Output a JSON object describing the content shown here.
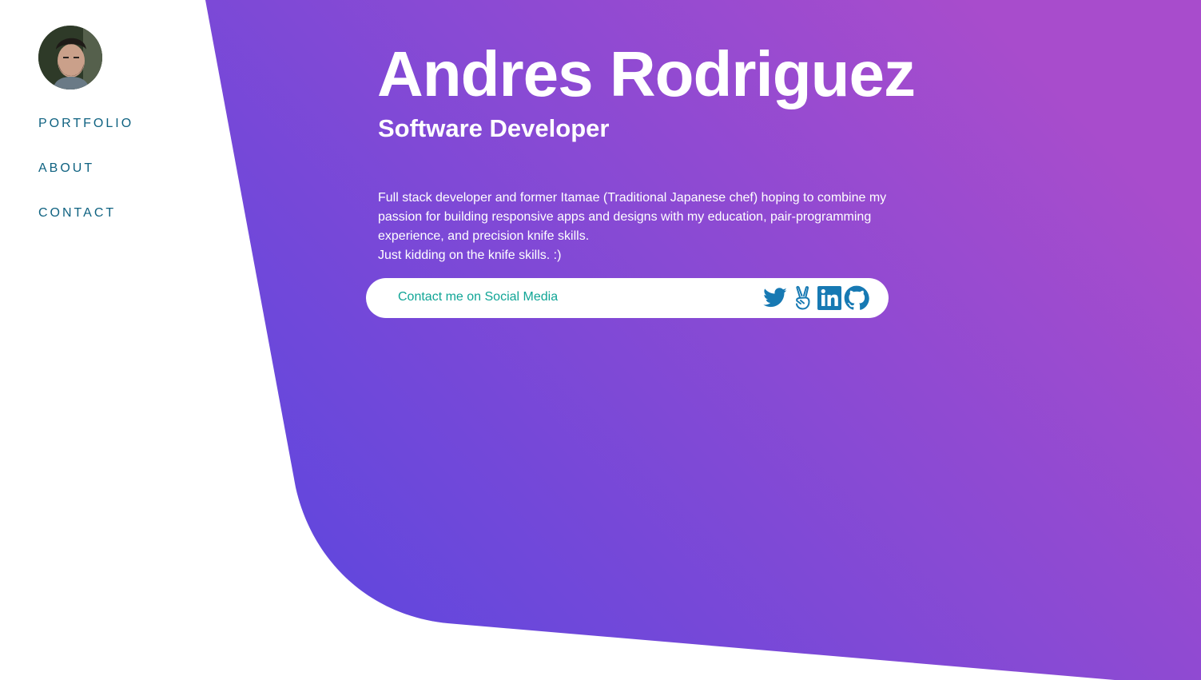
{
  "sidebar": {
    "avatar_alt": "Andres Rodriguez",
    "nav": [
      {
        "label": "PORTFOLIO"
      },
      {
        "label": "ABOUT"
      },
      {
        "label": "CONTACT"
      }
    ]
  },
  "hero": {
    "name": "Andres Rodriguez",
    "role": "Software Developer",
    "bio_lines": [
      "Full stack developer and former Itamae (Traditional Japanese chef) hoping to combine my passion for building responsive apps and designs with my education, pair-programming experience, and precision knife skills.",
      "Just kidding on the knife skills. :)"
    ]
  },
  "social": {
    "label": "Contact me on Social Media",
    "icons": [
      "twitter-icon",
      "angellist-icon",
      "linkedin-icon",
      "github-icon"
    ]
  },
  "colors": {
    "gradient_start": "#5646e0",
    "gradient_end": "#a74ccc",
    "nav_text": "#0f6281",
    "social_label": "#10a596",
    "icon_blue": "#1779b3"
  }
}
